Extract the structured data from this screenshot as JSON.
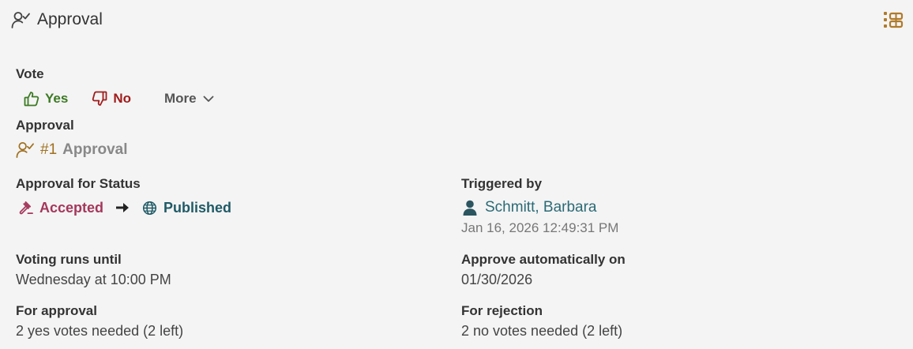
{
  "header": {
    "title": "Approval",
    "title_icon": "user-check-icon",
    "layout_icon": "layout-toggle-icon"
  },
  "vote": {
    "label": "Vote",
    "yes_label": "Yes",
    "no_label": "No",
    "more_label": "More",
    "colors": {
      "yes": "#3c7a23",
      "no": "#a01c1c"
    }
  },
  "approval": {
    "label": "Approval",
    "number": "#1",
    "name": "Approval"
  },
  "status": {
    "label": "Approval for Status",
    "from": "Accepted",
    "to": "Published",
    "from_icon": "gavel-icon",
    "to_icon": "globe-icon",
    "colors": {
      "from": "#a4375b",
      "to": "#1f5a66"
    }
  },
  "triggered": {
    "label": "Triggered by",
    "user": "Schmitt, Barbara",
    "timestamp": "Jan 16, 2026 12:49:31 PM"
  },
  "voting_until": {
    "label": "Voting runs until",
    "value": "Wednesday at 10:00 PM"
  },
  "auto_approve": {
    "label": "Approve automatically on",
    "value": "01/30/2026"
  },
  "for_approval": {
    "label": "For approval",
    "value": "2 yes votes needed (2 left)"
  },
  "for_rejection": {
    "label": "For rejection",
    "value": "2 no votes needed (2 left)"
  }
}
